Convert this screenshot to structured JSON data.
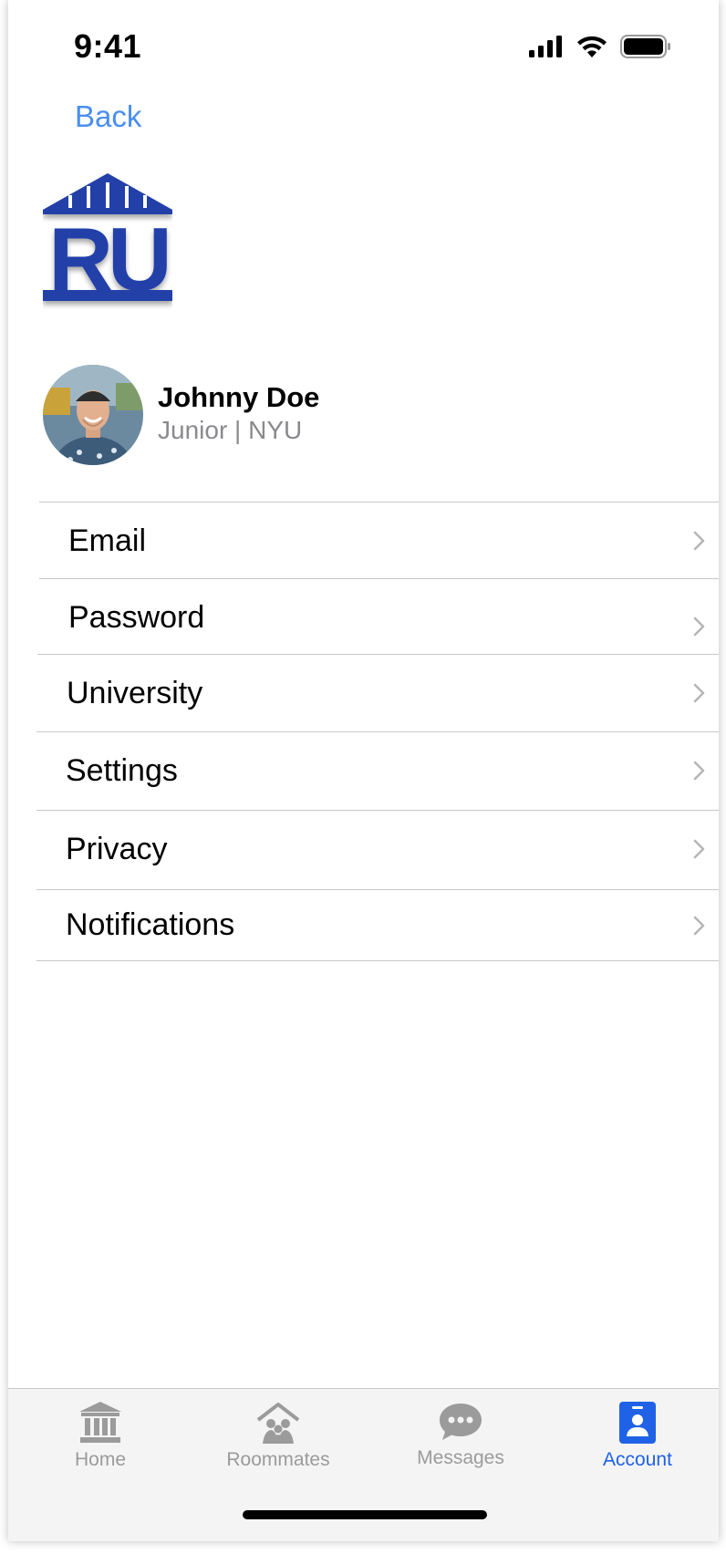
{
  "status_bar": {
    "time": "9:41"
  },
  "nav": {
    "back_label": "Back"
  },
  "logo": {
    "letters": "RU",
    "color": "#2341a8"
  },
  "profile": {
    "name": "Johnny Doe",
    "subtitle": "Junior | NYU"
  },
  "menu": {
    "items": [
      {
        "label": "Email"
      },
      {
        "label": "Password"
      },
      {
        "label": "University"
      },
      {
        "label": "Settings"
      },
      {
        "label": "Privacy"
      },
      {
        "label": "Notifications"
      }
    ]
  },
  "tabbar": {
    "tabs": [
      {
        "label": "Home",
        "icon": "bank-icon"
      },
      {
        "label": "Roommates",
        "icon": "people-house-icon"
      },
      {
        "label": "Messages",
        "icon": "chat-bubble-icon"
      },
      {
        "label": "Account",
        "icon": "id-badge-icon"
      }
    ],
    "active_color": "#1f62e6",
    "inactive_color": "#9b9b9b"
  }
}
